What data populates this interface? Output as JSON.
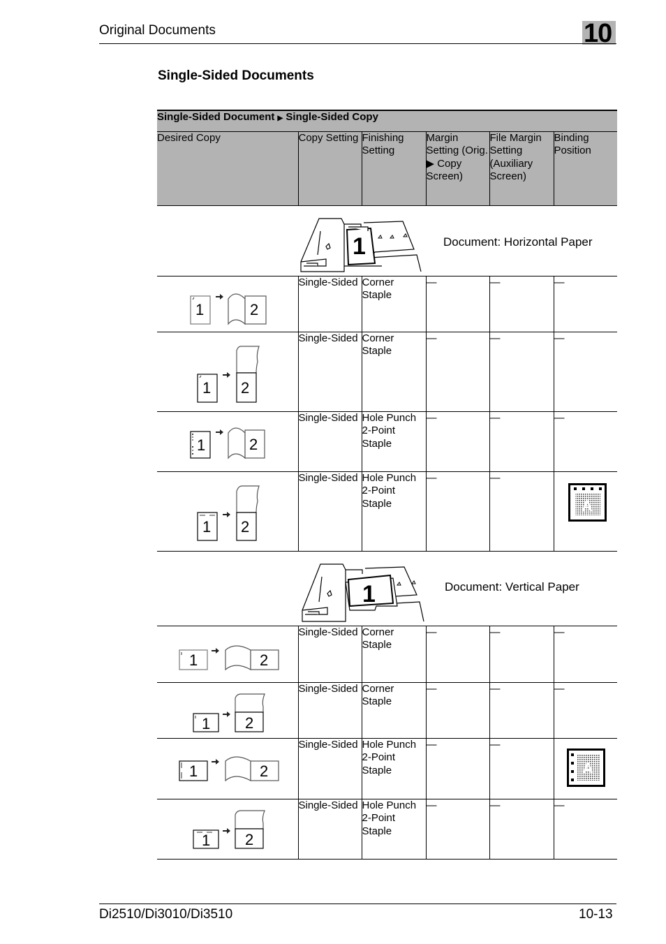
{
  "header": {
    "title": "Original Documents",
    "chapter": "10"
  },
  "section": {
    "title": "Single-Sided Documents"
  },
  "table": {
    "title_left": "Single-Sided Document",
    "title_arrow": "▶",
    "title_right": "Single-Sided Copy",
    "columns": [
      "Desired Copy",
      "Copy Setting",
      "Finishing Setting",
      "Margin Setting (Orig. ▶ Copy Screen)",
      "File Margin Setting (Auxiliary Screen)",
      "Binding Position"
    ],
    "groups": [
      {
        "document_label": "Document: Horizontal Paper",
        "machine_icon": "copier-adf-horizontal-icon",
        "rows": [
          {
            "diagram": "corner-staple-book-horizontal",
            "copy_setting": "Single-Sided",
            "finishing": "Corner Staple",
            "margin": "—",
            "file_margin": "—",
            "binding": "—"
          },
          {
            "diagram": "corner-staple-tablet-horizontal",
            "copy_setting": "Single-Sided",
            "finishing": "Corner Staple",
            "margin": "—",
            "file_margin": "—",
            "binding": "—"
          },
          {
            "diagram": "hole-punch-book-horizontal",
            "copy_setting": "Single-Sided",
            "finishing": "Hole Punch 2-Point Staple",
            "margin": "—",
            "file_margin": "—",
            "binding": "—"
          },
          {
            "diagram": "hole-punch-tablet-horizontal",
            "copy_setting": "Single-Sided",
            "finishing": "Hole Punch 2-Point Staple",
            "margin": "—",
            "file_margin": "—",
            "binding": "top-binding-icon"
          }
        ]
      },
      {
        "document_label": "Document: Vertical Paper",
        "machine_icon": "copier-adf-vertical-icon",
        "rows": [
          {
            "diagram": "corner-staple-book-vertical",
            "copy_setting": "Single-Sided",
            "finishing": "Corner Staple",
            "margin": "—",
            "file_margin": "—",
            "binding": "—"
          },
          {
            "diagram": "corner-staple-tablet-vertical",
            "copy_setting": "Single-Sided",
            "finishing": "Corner Staple",
            "margin": "—",
            "file_margin": "—",
            "binding": "—"
          },
          {
            "diagram": "hole-punch-book-vertical",
            "copy_setting": "Single-Sided",
            "finishing": "Hole Punch 2-Point Staple",
            "margin": "—",
            "file_margin": "—",
            "binding": "left-binding-icon"
          },
          {
            "diagram": "hole-punch-tablet-vertical",
            "copy_setting": "Single-Sided",
            "finishing": "Hole Punch 2-Point Staple",
            "margin": "—",
            "file_margin": "—",
            "binding": "—"
          }
        ]
      }
    ],
    "page_numbers": {
      "original": "1",
      "copy": "2"
    }
  },
  "footer": {
    "model": "Di2510/Di3010/Di3510",
    "page": "10-13"
  },
  "colors": {
    "header_fill": "#b3b3b3",
    "rule": "#000000"
  }
}
